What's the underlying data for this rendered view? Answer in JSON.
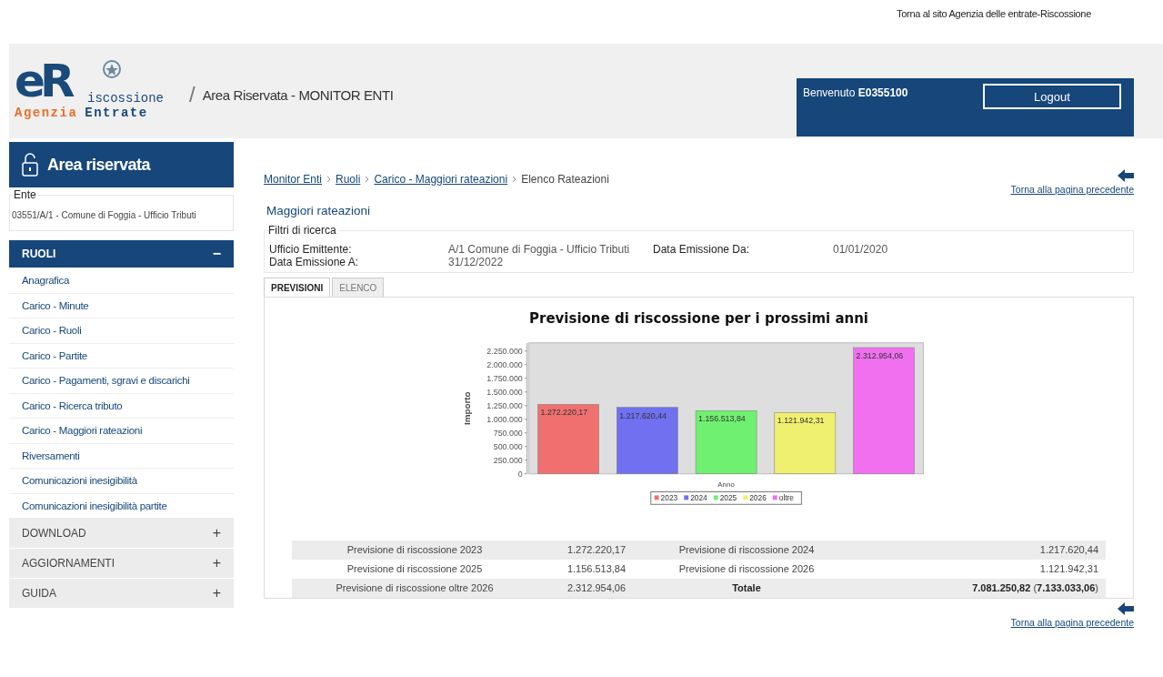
{
  "top_link": "Torna al sito Agenzia delle entrate-Riscossione",
  "header": {
    "logo": {
      "mark": "eR",
      "word": "iscossione",
      "line1": "Agenzia",
      "line2": "Entrate"
    },
    "separator": "/",
    "title": "Area Riservata - MONITOR ENTI",
    "welcome": "Benvenuto",
    "user": "E0355100",
    "logout": "Logout"
  },
  "sidebar": {
    "title": "Area riservata",
    "ente_label": "Ente",
    "ente_value": "03551/A/1 - Comune di Foggia - Ufficio Tributi",
    "sections": [
      {
        "label": "RUOLI",
        "expanded": true,
        "toggle": "−",
        "items": [
          {
            "label": "Anagrafica",
            "selected": false
          },
          {
            "label": "Carico - Minute",
            "selected": false
          },
          {
            "label": "Carico - Ruoli",
            "selected": false
          },
          {
            "label": "Carico - Partite",
            "selected": false
          },
          {
            "label": "Carico - Pagamenti, sgravi e discarichi",
            "selected": false
          },
          {
            "label": "Carico - Ricerca tributo",
            "selected": false
          },
          {
            "label": "Carico - Maggiori rateazioni",
            "selected": false
          },
          {
            "label": "Riversamenti",
            "selected": false
          },
          {
            "label": "Comunicazioni inesigibilità",
            "selected": false
          },
          {
            "label": "Comunicazioni inesigibilità partite",
            "selected": false
          }
        ]
      },
      {
        "label": "DOWNLOAD",
        "expanded": false,
        "toggle": "+"
      },
      {
        "label": "AGGIORNAMENTI",
        "expanded": false,
        "toggle": "+"
      },
      {
        "label": "GUIDA",
        "expanded": false,
        "toggle": "+"
      }
    ]
  },
  "breadcrumb": [
    {
      "label": "Monitor Enti",
      "link": true
    },
    {
      "label": "Ruoli",
      "link": true
    },
    {
      "label": "Carico - Maggiori rateazioni",
      "link": true
    },
    {
      "label": "Elenco Rateazioni",
      "link": false
    }
  ],
  "back_link_top": "Torna alla pagina precedente",
  "page_title": "Maggiori rateazioni",
  "filters": {
    "legend": "Filtri di ricerca",
    "fields": [
      {
        "label": "Ufficio Emittente:",
        "value": "A/1 Comune di Foggia - Ufficio Tributi"
      },
      {
        "label": "Data Emissione Da:",
        "value": "01/01/2020"
      },
      {
        "label": "Data Emissione A:",
        "value": "31/12/2022"
      }
    ]
  },
  "tabs": [
    {
      "label": "PREVISIONI",
      "selected": true
    },
    {
      "label": "ELENCO",
      "selected": false
    }
  ],
  "chart": {
    "chart_data": {
      "type": "bar",
      "title": "Previsione di riscossione per i prossimi anni",
      "xlabel": "Anno",
      "ylabel": "Importo",
      "ylim": [
        0,
        2400000
      ],
      "legend": "bottom",
      "yticks": [
        {
          "value": 0,
          "label": "0"
        },
        {
          "value": 250000,
          "label": "250.000"
        },
        {
          "value": 500000,
          "label": "500.000"
        },
        {
          "value": 750000,
          "label": "750.000"
        },
        {
          "value": 1000000,
          "label": "1.000.000"
        },
        {
          "value": 1250000,
          "label": "1.250.000"
        },
        {
          "value": 1500000,
          "label": "1.500.000"
        },
        {
          "value": 1750000,
          "label": "1.750.000"
        },
        {
          "value": 2000000,
          "label": "2.000.000"
        },
        {
          "value": 2250000,
          "label": "2.250.000"
        }
      ],
      "series": [
        {
          "name": "2023",
          "color": "#f07070",
          "values": [
            1272000
          ]
        },
        {
          "name": "2024",
          "color": "#7070f0",
          "values": [
            1218000
          ]
        },
        {
          "name": "2025",
          "color": "#70f070",
          "values": [
            1157000
          ]
        },
        {
          "name": "2026",
          "color": "#f0f070",
          "values": [
            1122000
          ]
        },
        {
          "name": "oltre",
          "color": "#f070f0",
          "values": [
            2313000
          ]
        }
      ],
      "value_labels": [
        "1.272.220,17",
        "1.217.620,44",
        "1.156.513,84",
        "1.121.942,31",
        "2.312.954,06"
      ]
    }
  },
  "summary": [
    [
      "Previsione di riscossione 2023",
      "1.272.220,17",
      "Previsione di riscossione 2024",
      "1.217.620,44"
    ],
    [
      "Previsione di riscossione 2025",
      "1.156.513,84",
      "Previsione di riscossione 2026",
      "1.121.942,31"
    ],
    [
      "Previsione di riscossione oltre 2026",
      "2.312.954,06",
      "**Totale**",
      "**7.081.250,82** (**7.133.033,06**)"
    ]
  ],
  "back_link_bottom": "Torna alla pagina precedente"
}
